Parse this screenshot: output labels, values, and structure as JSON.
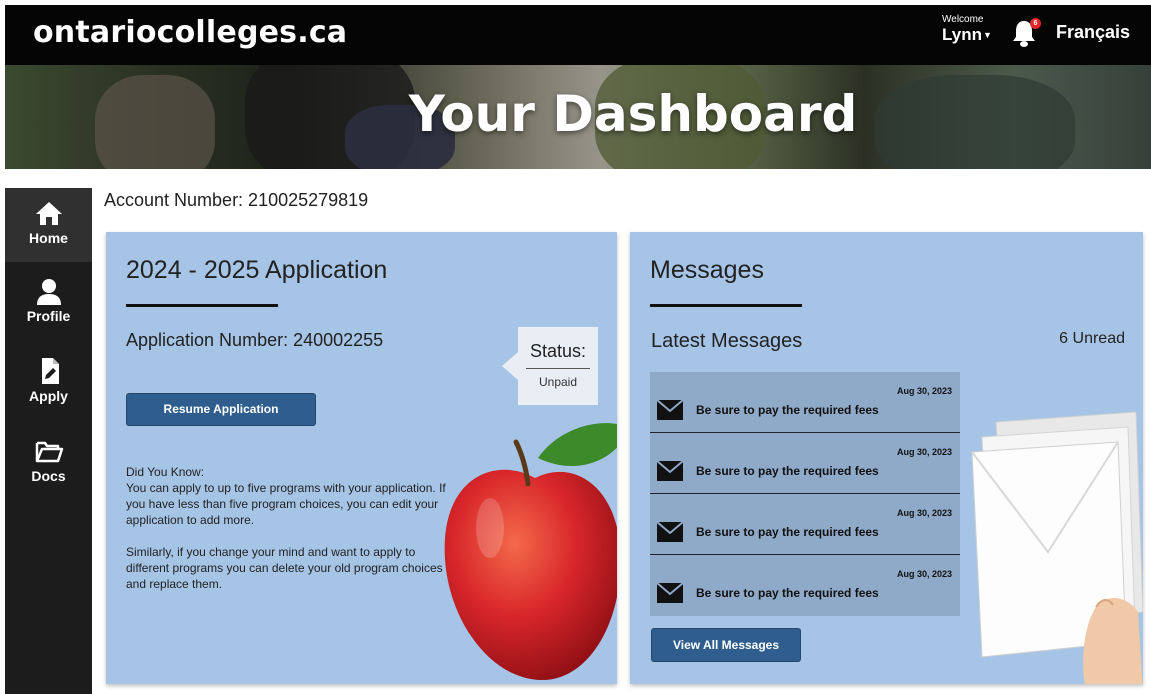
{
  "header": {
    "brand": "ontariocolleges.ca",
    "welcome_label": "Welcome",
    "user_name": "Lynn",
    "notification_count": "6",
    "language_link": "Français"
  },
  "hero": {
    "title": "Your Dashboard"
  },
  "sidebar": {
    "items": [
      {
        "label": "Home",
        "icon": "home-icon",
        "active": true
      },
      {
        "label": "Profile",
        "icon": "person-icon"
      },
      {
        "label": "Apply",
        "icon": "document-edit-icon"
      },
      {
        "label": "Docs",
        "icon": "folder-icon"
      }
    ]
  },
  "account": {
    "label": "Account Number: 210025279819"
  },
  "application": {
    "title": "2024 - 2025 Application",
    "number_label": "Application Number: 240002255",
    "status_label": "Status:",
    "status_value": "Unpaid",
    "resume_button": "Resume Application",
    "tip_heading": "Did You Know:",
    "tip_1": "You can apply to up to five programs with your application. If you have less than five program choices, you can edit your application to add more.",
    "tip_2": "Similarly, if you change your mind and want to apply to different programs you can delete your old program choices and replace them."
  },
  "messages": {
    "title": "Messages",
    "latest_heading": "Latest Messages",
    "unread_label": "6 Unread",
    "items": [
      {
        "date": "Aug 30, 2023",
        "subject": "Be sure to pay the required fees"
      },
      {
        "date": "Aug 30, 2023",
        "subject": "Be sure to pay the required fees"
      },
      {
        "date": "Aug 30, 2023",
        "subject": "Be sure to pay the required fees"
      },
      {
        "date": "Aug 30, 2023",
        "subject": "Be sure to pay the required fees"
      }
    ],
    "view_all_button": "View All Messages"
  },
  "colors": {
    "topbar": "#050505",
    "card_background": "#a6c4e6",
    "button": "#2f5e8e",
    "sidebar": "#1c1c1c"
  }
}
